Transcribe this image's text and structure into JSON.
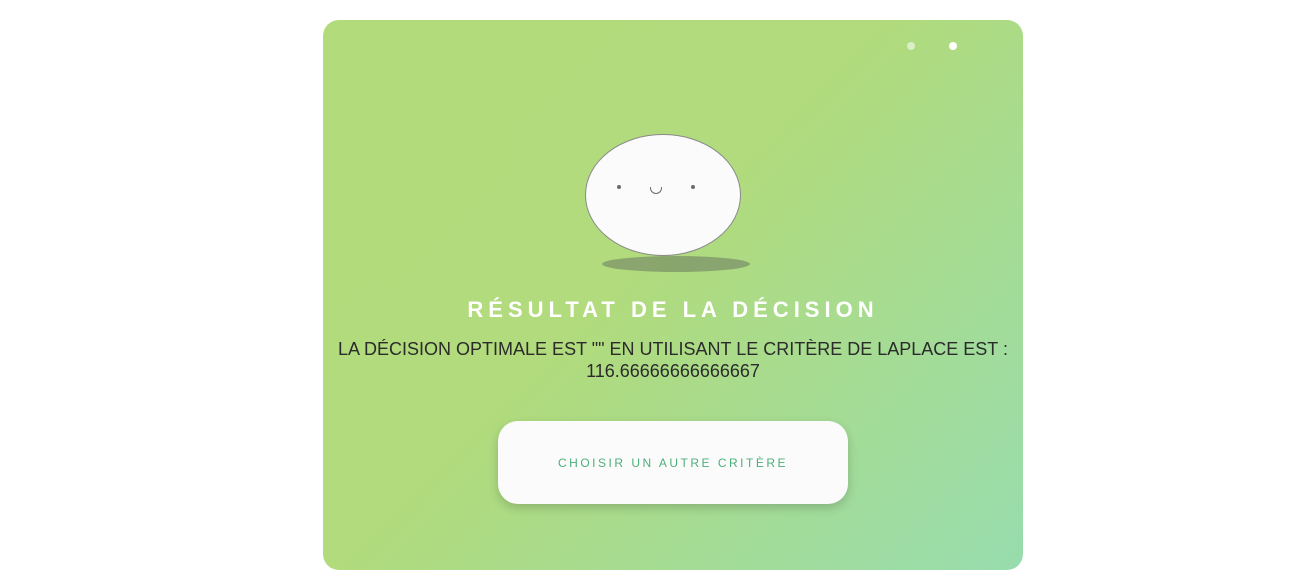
{
  "result": {
    "title": "RÉSULTAT DE LA DÉCISION",
    "message": "LA DÉCISION OPTIMALE EST \"\" EN UTILISANT LE CRITÈRE DE LAPLACE EST : 116.66666666666667",
    "button_label": "CHOISIR UN AUTRE CRITÈRE"
  },
  "pagination": {
    "count": 2,
    "active_index": 1
  },
  "colors": {
    "gradient_start": "#b2db7c",
    "gradient_end": "#98dcae",
    "title": "#ffffff",
    "message": "#2b2b2b",
    "button_text": "#4caf7a",
    "button_bg": "#fbfbfb"
  },
  "icons": {
    "mascot": "smiling-egg-face-icon"
  }
}
